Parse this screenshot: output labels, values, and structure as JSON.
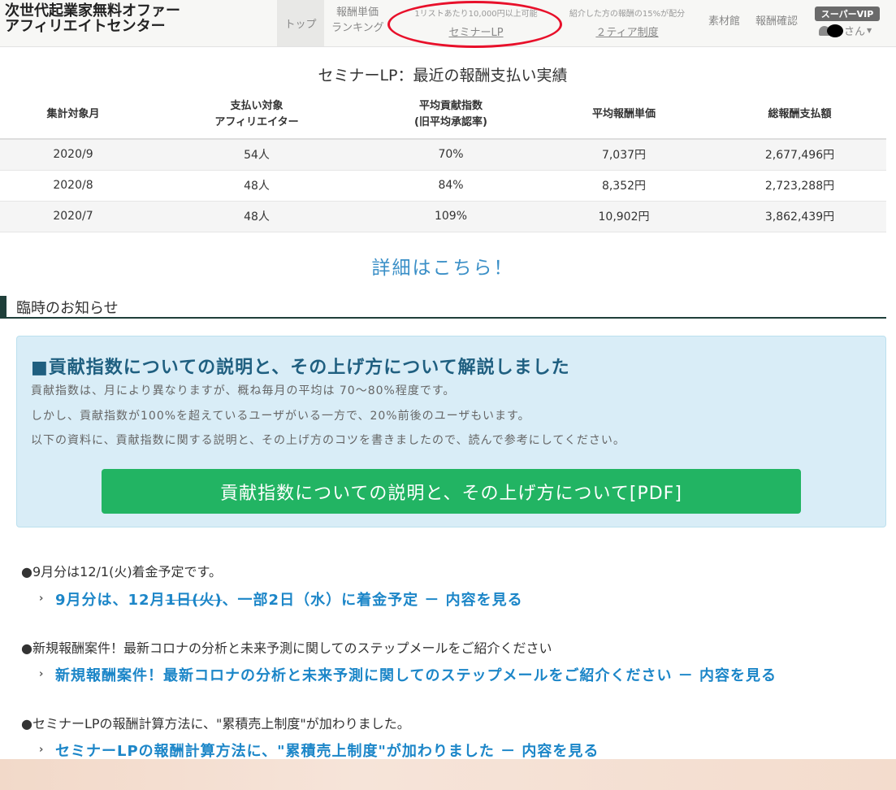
{
  "header": {
    "brand_line1": "次世代起業家無料オファー",
    "brand_line2": "アフィリエイトセンター",
    "nav_top": "トップ",
    "nav_ranking_line1": "報酬単価",
    "nav_ranking_line2": "ランキング",
    "nav_seminar_small": "1リストあたり10,000円以上可能",
    "nav_seminar_link": "セミナーLP",
    "nav_tier_small": "紹介した方の報酬の15%が配分",
    "nav_tier_link": "２ティア制度",
    "nav_materials": "素材館",
    "nav_payments": "報酬確認",
    "vip_badge": "スーパーVIP",
    "user_suffix": "さん"
  },
  "results": {
    "title": "セミナーLP：最近の報酬支払い実績",
    "columns": [
      "集計対象月",
      "支払い対象\nアフィリエイター",
      "平均貢献指数\n(旧平均承認率)",
      "平均報酬単価",
      "総報酬支払額"
    ],
    "col_month": "集計対象月",
    "col_affiliates_line1": "支払い対象",
    "col_affiliates_line2": "アフィリエイター",
    "col_index_line1": "平均貢献指数",
    "col_index_line2": "(旧平均承認率)",
    "col_unit": "平均報酬単価",
    "col_total": "総報酬支払額",
    "rows": [
      {
        "month": "2020/9",
        "affiliates": "54人",
        "index": "70%",
        "unit": "7,037円",
        "total": "2,677,496円"
      },
      {
        "month": "2020/8",
        "affiliates": "48人",
        "index": "84%",
        "unit": "8,352円",
        "total": "2,723,288円"
      },
      {
        "month": "2020/7",
        "affiliates": "48人",
        "index": "109%",
        "unit": "10,902円",
        "total": "3,862,439円"
      }
    ],
    "detail_link": "詳細はこちら！"
  },
  "notice": {
    "heading": "臨時のお知らせ",
    "box_title": "■貢献指数についての説明と、その上げ方について解説しました",
    "line1": "貢献指数は、月により異なりますが、概ね毎月の平均は 70～80%程度です。",
    "line2": "しかし、貢献指数が100%を超えているユーザがいる一方で、20%前後のユーザもいます。",
    "line3": "以下の資料に、貢献指数に関する説明と、その上げ方のコツを書きましたので、読んで参考にしてください。",
    "pdf_button": "貢献指数についての説明と、その上げ方について[PDF]"
  },
  "news": [
    {
      "summary": "●9月分は12/1(火)着金予定です。",
      "link_pre": "9月分は、12月",
      "link_strike": "1日(火)",
      "link_post": "、一部2日（水）に着金予定 － 内容を見る"
    },
    {
      "summary": "●新規報酬案件！最新コロナの分析と未来予測に関してのステップメールをご紹介ください",
      "link": "新規報酬案件！最新コロナの分析と未来予測に関してのステップメールをご紹介ください － 内容を見る"
    },
    {
      "summary": "●セミナーLPの報酬計算方法に、\"累積売上制度\"が加わりました。",
      "link": "セミナーLPの報酬計算方法に、\"累積売上制度\"が加わりました － 内容を見る"
    }
  ],
  "icons": {
    "chevron": "chevron-right-icon",
    "avatar": "user-avatar-icon"
  },
  "colors": {
    "link_blue": "#1c86c8",
    "pdf_green": "#22b463",
    "info_bg": "#d9edf7",
    "highlight_circle": "#e8102a"
  }
}
